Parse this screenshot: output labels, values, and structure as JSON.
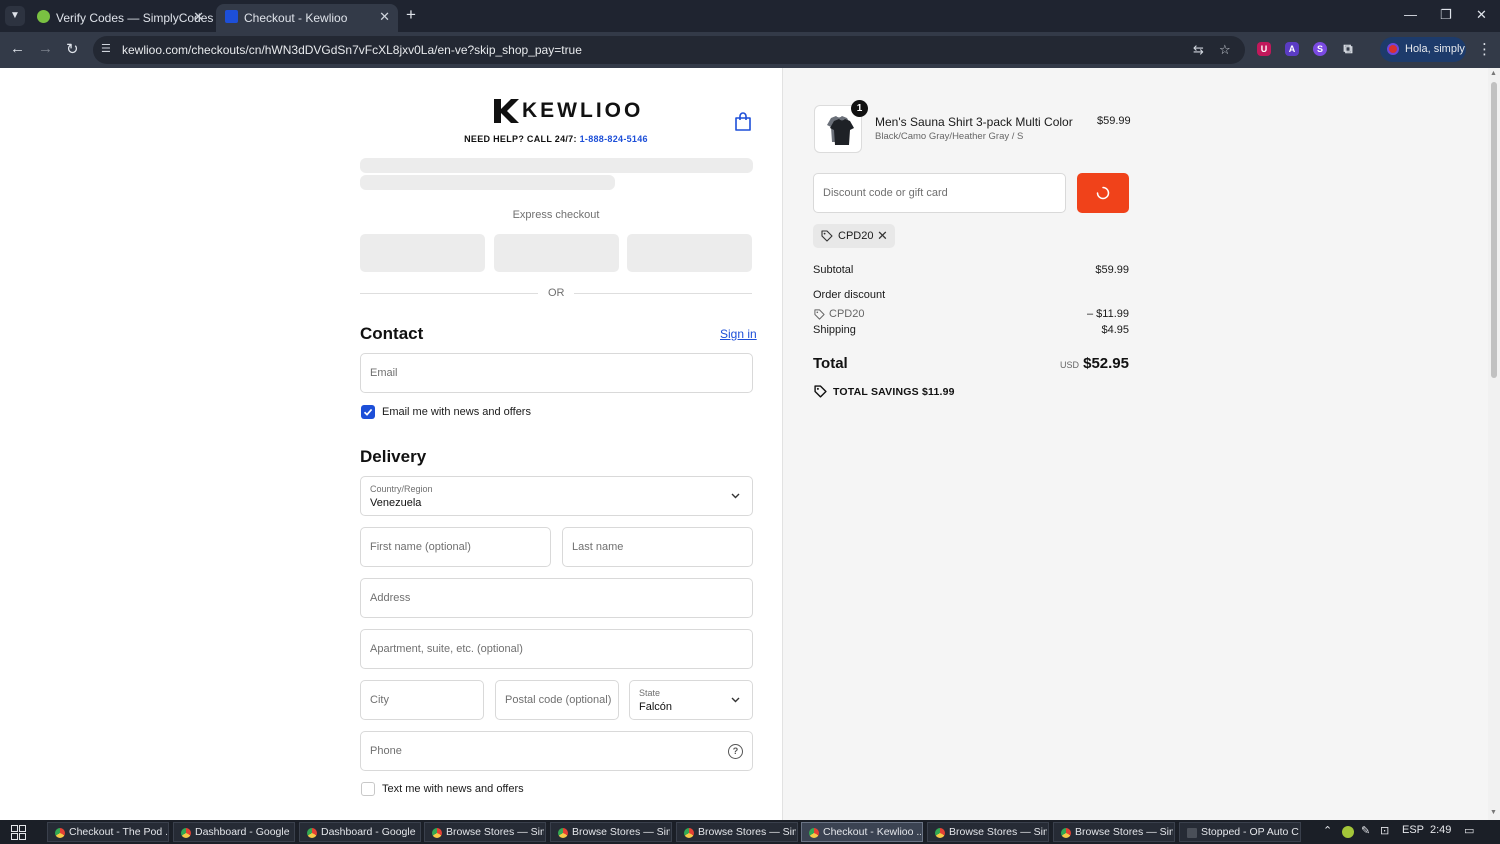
{
  "browser": {
    "tabs": [
      {
        "title": "Verify Codes — SimplyCodes",
        "active": false
      },
      {
        "title": "Checkout - Kewlioo",
        "active": true
      }
    ],
    "url": "kewlioo.com/checkouts/cn/hWN3dDVGdSn7vFcXL8jxv0La/en-ve?skip_shop_pay=true",
    "profile_label": "Hola, simply"
  },
  "header": {
    "logo_text": "KEWLIOO",
    "help_prefix": "NEED HELP? CALL 24/7:",
    "help_phone": "1-888-824-5146"
  },
  "express": {
    "label": "Express checkout",
    "or_label": "OR"
  },
  "contact": {
    "title": "Contact",
    "sign_in": "Sign in",
    "email_placeholder": "Email",
    "news_label": "Email me with news and offers",
    "news_checked": true
  },
  "delivery": {
    "title": "Delivery",
    "country_label": "Country/Region",
    "country_value": "Venezuela",
    "first_name_placeholder": "First name (optional)",
    "last_name_placeholder": "Last name",
    "address_placeholder": "Address",
    "apartment_placeholder": "Apartment, suite, etc. (optional)",
    "city_placeholder": "City",
    "postal_placeholder": "Postal code (optional)",
    "state_label": "State",
    "state_value": "Falcón",
    "phone_placeholder": "Phone",
    "text_label": "Text me with news and offers",
    "text_checked": false
  },
  "order": {
    "item": {
      "quantity": "1",
      "name": "Men's Sauna Shirt 3-pack Multi Color",
      "variant": "Black/Camo Gray/Heather Gray / S",
      "price": "$59.99"
    },
    "discount_placeholder": "Discount code or gift card",
    "applied_code": "CPD20",
    "subtotal_label": "Subtotal",
    "subtotal_value": "$59.99",
    "order_discount_label": "Order discount",
    "discount_code": "CPD20",
    "discount_value": "– $11.99",
    "shipping_label": "Shipping",
    "shipping_value": "$4.95",
    "total_label": "Total",
    "total_currency": "USD",
    "total_value": "$52.95",
    "savings_text": "TOTAL SAVINGS  $11.99"
  },
  "colors": {
    "accent_blue": "#1d4fd8",
    "apply_button": "#f0421a"
  },
  "taskbar": {
    "items": [
      {
        "label": "Checkout - The Pod ..."
      },
      {
        "label": "Dashboard - Google ..."
      },
      {
        "label": "Dashboard - Google ..."
      },
      {
        "label": "Browse Stores — Sim..."
      },
      {
        "label": "Browse Stores — Sim..."
      },
      {
        "label": "Browse Stores — Sim..."
      },
      {
        "label": "Checkout - Kewlioo ..."
      },
      {
        "label": "Browse Stores — Sim..."
      },
      {
        "label": "Browse Stores — Sim..."
      },
      {
        "label": "Stopped - OP Auto C..."
      }
    ],
    "language": "ESP",
    "time": "2:49"
  }
}
